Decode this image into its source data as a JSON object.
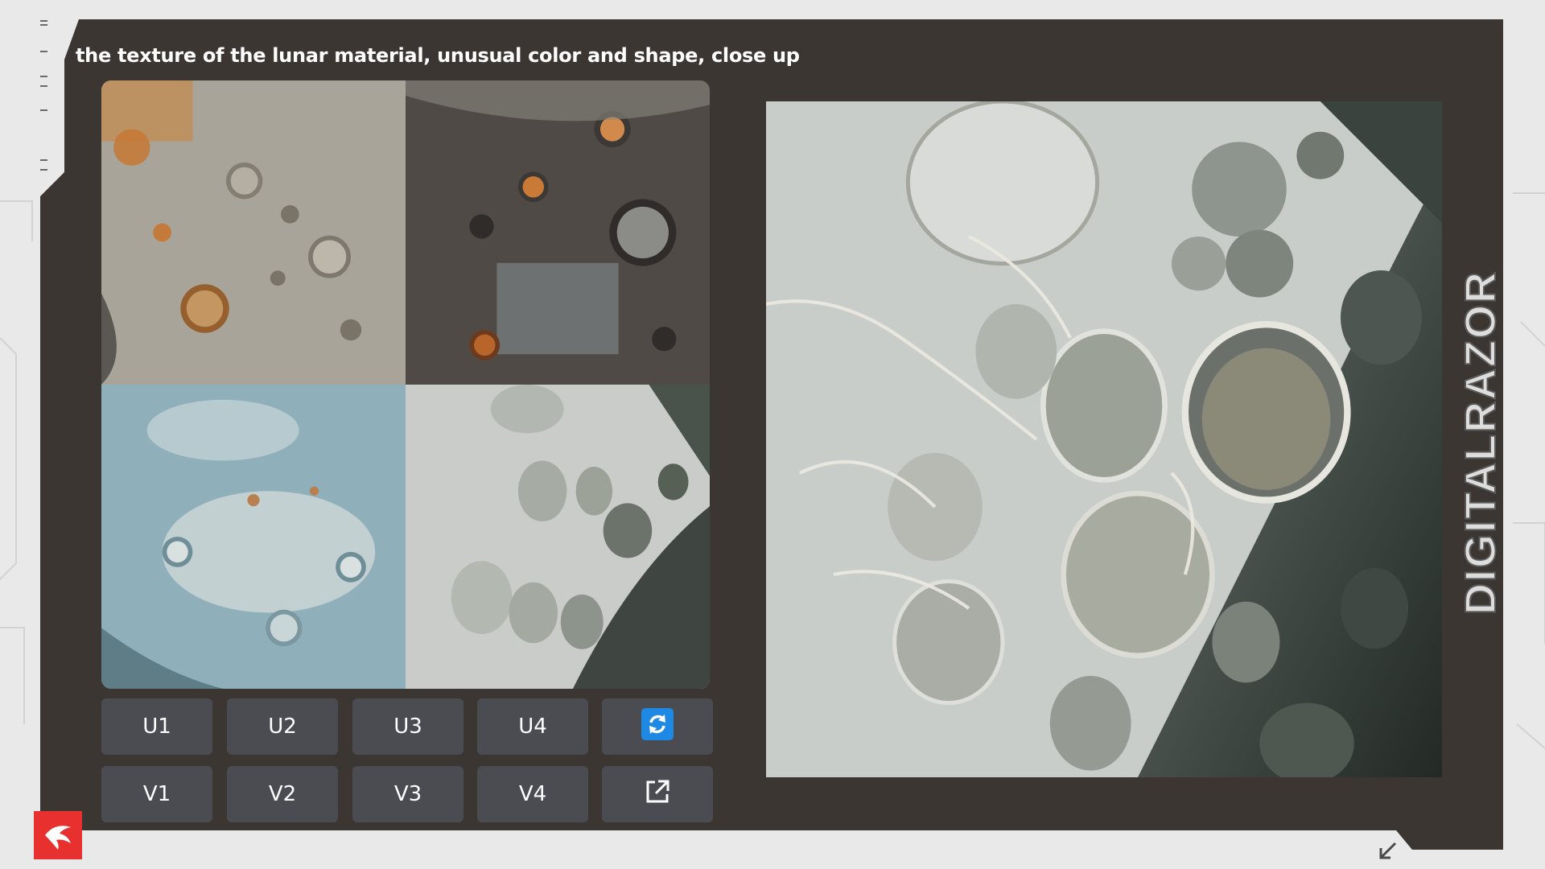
{
  "prompt": "the texture of the lunar material, unusual color and shape, close up",
  "brand": "DIGITALRAZOR",
  "grid_images": [
    {
      "description_icon": "moon-crater-texture-orange"
    },
    {
      "description_icon": "moon-crater-texture-dark-rust"
    },
    {
      "description_icon": "moon-crater-texture-blue"
    },
    {
      "description_icon": "moon-crater-texture-white-teal"
    }
  ],
  "buttons": {
    "u1": "U1",
    "u2": "U2",
    "u3": "U3",
    "u4": "U4",
    "v1": "V1",
    "v2": "V2",
    "v3": "V3",
    "v4": "V4"
  },
  "icons": {
    "reroll": "refresh-icon",
    "web": "external-link-icon",
    "logo": "digitalrazor-logo-icon",
    "corner": "arrow-down-left-icon"
  },
  "colors": {
    "panel": "#3b3632",
    "button": "#4b4c52",
    "reroll_blue": "#1e88e5",
    "logo_red": "#e8312f",
    "background": "#e9e9e9"
  }
}
